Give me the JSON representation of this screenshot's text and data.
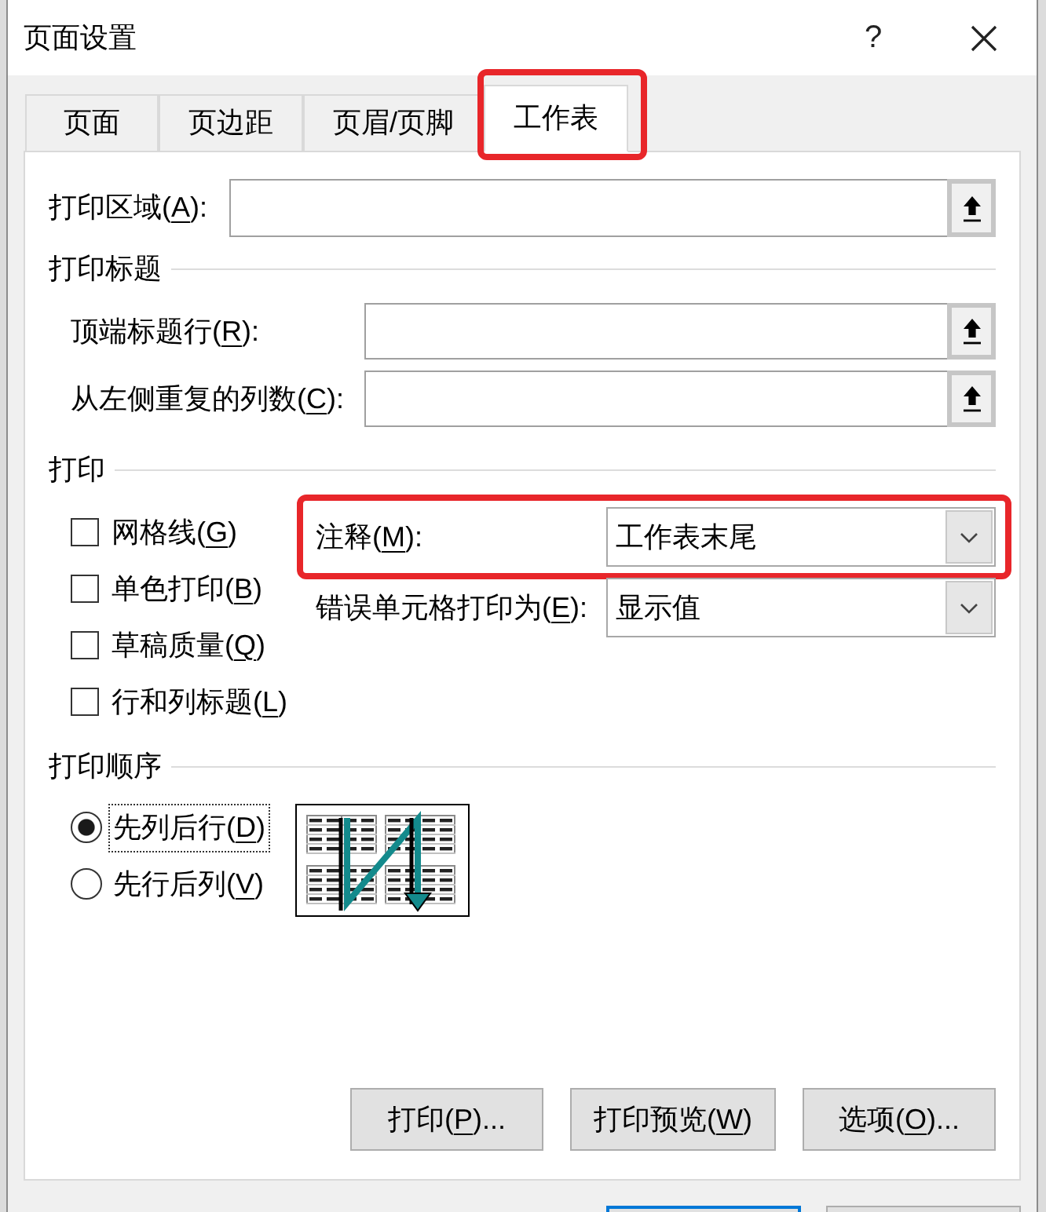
{
  "window": {
    "title": "页面设置",
    "help": "?"
  },
  "tabs": [
    {
      "label": "页面",
      "selected": false,
      "highlighted": false
    },
    {
      "label": "页边距",
      "selected": false,
      "highlighted": false
    },
    {
      "label": "页眉/页脚",
      "selected": false,
      "highlighted": false
    },
    {
      "label": "工作表",
      "selected": true,
      "highlighted": true
    }
  ],
  "print_area": {
    "label": {
      "before": "打印区域(",
      "key": "A",
      "after": "):"
    }
  },
  "print_titles": {
    "title": "打印标题",
    "fields": [
      {
        "label": {
          "before": "顶端标题行(",
          "key": "R",
          "after": "):"
        }
      },
      {
        "label": {
          "before": "从左侧重复的列数(",
          "key": "C",
          "after": "):"
        }
      }
    ]
  },
  "print": {
    "title": "打印",
    "options": [
      {
        "label": {
          "before": "网格线(",
          "key": "G",
          "after": ")"
        },
        "checked": false
      },
      {
        "label": {
          "before": "单色打印(",
          "key": "B",
          "after": ")"
        },
        "checked": false
      },
      {
        "label": {
          "before": "草稿质量(",
          "key": "Q",
          "after": ")"
        },
        "checked": false
      },
      {
        "label": {
          "before": "行和列标题(",
          "key": "L",
          "after": ")"
        },
        "checked": false
      }
    ],
    "selects": [
      {
        "label": {
          "before": "注释(",
          "key": "M",
          "after": "):"
        },
        "value": "工作表末尾",
        "highlighted": true
      },
      {
        "label": {
          "before": "错误单元格打印为(",
          "key": "E",
          "after": "):"
        },
        "value": "显示值",
        "highlighted": false
      }
    ]
  },
  "page_order": {
    "title": "打印顺序",
    "options": [
      {
        "label": {
          "before": "先列后行(",
          "key": "D",
          "after": ")"
        },
        "selected": true,
        "focused": true
      },
      {
        "label": {
          "before": "先行后列(",
          "key": "V",
          "after": ")"
        },
        "selected": false,
        "focused": false
      }
    ]
  },
  "buttons": [
    {
      "label": {
        "before": "打印(",
        "key": "P",
        "after": ")..."
      }
    },
    {
      "label": {
        "before": "打印预览(",
        "key": "W",
        "after": ")"
      }
    },
    {
      "label": {
        "before": "选项(",
        "key": "O",
        "after": ")..."
      }
    }
  ],
  "dialog_buttons": [
    {
      "default": true
    },
    {
      "default": false
    }
  ]
}
